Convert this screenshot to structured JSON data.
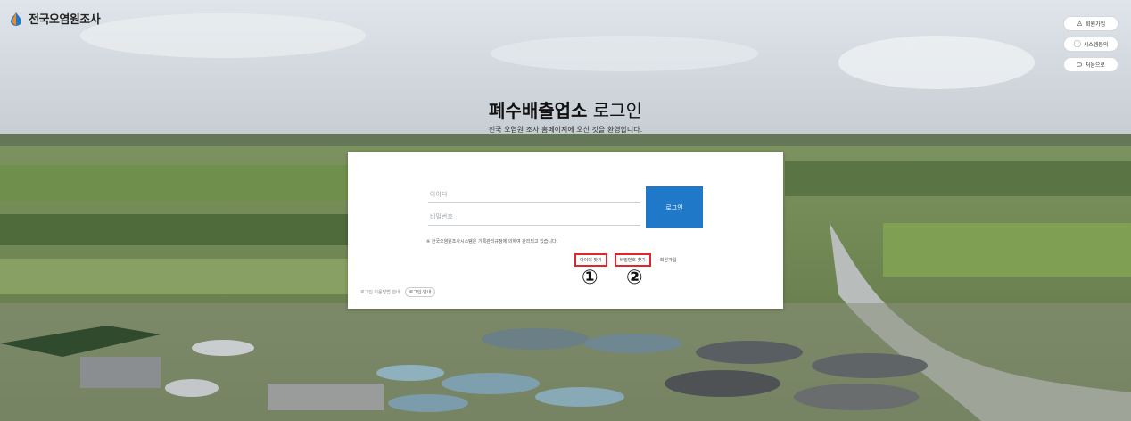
{
  "brand": {
    "name": "전국오염원조사",
    "icon": "drop-logo-icon"
  },
  "side_buttons": [
    {
      "label": "회원가입",
      "icon": "user-icon"
    },
    {
      "label": "시스템문의",
      "icon": "question-circle-icon"
    },
    {
      "label": "처음으로",
      "icon": "return-icon"
    }
  ],
  "title": {
    "bold": "폐수배출업소",
    "light": " 로그인"
  },
  "subtitle": "전국 오염원 조사 홈페이지에 오신 것을 환영합니다.",
  "login": {
    "id_placeholder": "아이디",
    "pw_placeholder": "비밀번호",
    "submit_label": "로그인",
    "notice": "※ 전국오염원조사시스템은 기록관리규정에 의하여 관리되고 있습니다.",
    "find_id_label": "아이디 찾기",
    "find_pw_label": "비밀번호 찾기",
    "join_label": "회원가입",
    "help_text": "로그인 이용방법 안내",
    "help_button_label": "로그인 안내"
  },
  "markers": {
    "first": "①",
    "second": "②"
  },
  "colors": {
    "primary": "#1f78c8",
    "highlight": "#e0262c"
  }
}
